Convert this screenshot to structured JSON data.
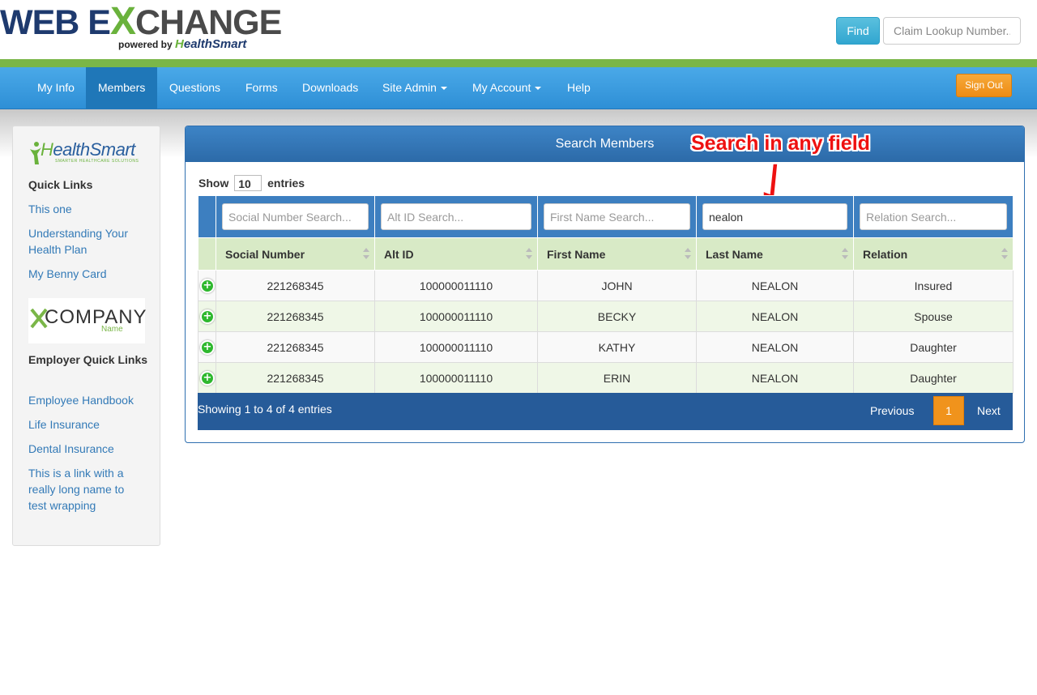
{
  "header": {
    "logo_web": "WEB E",
    "logo_x": "X",
    "logo_change": "CHANGE",
    "logo_powered": "powered by",
    "logo_brand_h": "H",
    "logo_brand_rest": "ealthSmart",
    "find_label": "Find",
    "claim_placeholder": "Claim Lookup Number..."
  },
  "nav": {
    "items": [
      {
        "label": "My Info"
      },
      {
        "label": "Members"
      },
      {
        "label": "Questions"
      },
      {
        "label": "Forms"
      },
      {
        "label": "Downloads"
      },
      {
        "label": "Site Admin"
      },
      {
        "label": "My Account"
      },
      {
        "label": "Help"
      }
    ],
    "active": "Members",
    "signout_label": "Sign Out"
  },
  "sidebar": {
    "brand_h": "H",
    "brand_rest": "ealthSmart",
    "brand_tagline": "SMARTER HEALTHCARE SOLUTIONS",
    "quick_links_heading": "Quick Links",
    "quick_links": [
      {
        "label": "This one"
      },
      {
        "label": "Understanding Your Health Plan"
      },
      {
        "label": "My Benny Card"
      }
    ],
    "company_logo_text": "COMPANY",
    "company_logo_sub": "Name",
    "employer_heading": "Employer Quick Links",
    "employer_links": [
      {
        "label": "Employee Handbook"
      },
      {
        "label": "Life Insurance"
      },
      {
        "label": "Dental Insurance"
      },
      {
        "label": "This is a link with a really long name to test wrapping"
      }
    ]
  },
  "panel": {
    "title": "Search Members",
    "annotation": "Search in any field",
    "show_label": "Show",
    "entries_value": "10",
    "entries_label": "entries",
    "filters": {
      "social": {
        "placeholder": "Social Number Search...",
        "value": ""
      },
      "alt": {
        "placeholder": "Alt ID Search...",
        "value": ""
      },
      "first": {
        "placeholder": "First Name Search...",
        "value": ""
      },
      "last": {
        "placeholder": "Last Name Search...",
        "value": "nealon"
      },
      "relation": {
        "placeholder": "Relation Search...",
        "value": ""
      }
    },
    "columns": [
      "Social Number",
      "Alt ID",
      "First Name",
      "Last Name",
      "Relation"
    ],
    "rows": [
      [
        "221268345",
        "100000011110",
        "JOHN",
        "NEALON",
        "Insured"
      ],
      [
        "221268345",
        "100000011110",
        "BECKY",
        "NEALON",
        "Spouse"
      ],
      [
        "221268345",
        "100000011110",
        "KATHY",
        "NEALON",
        "Daughter"
      ],
      [
        "221268345",
        "100000011110",
        "ERIN",
        "NEALON",
        "Daughter"
      ]
    ],
    "expand_icon": "+",
    "showing_text": "Showing 1 to 4 of 4 entries",
    "prev_label": "Previous",
    "page_number": "1",
    "next_label": "Next"
  },
  "colors": {
    "nav_blue": "#2e8fd6",
    "accent_green": "#7ab648",
    "signout_orange": "#ee8c14",
    "annotation_red": "#ee1111",
    "panel_navy": "#265b99"
  }
}
